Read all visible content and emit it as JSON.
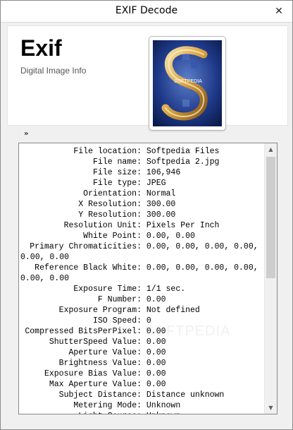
{
  "window": {
    "title": "EXIF Decode",
    "close_glyph": "✕"
  },
  "header": {
    "app_name": "Exif",
    "subtitle": "Digital Image Info",
    "thumbnail_text": "SOFTPEDIA"
  },
  "expand_glyph": "»",
  "exif_rows": [
    {
      "label": "File location:",
      "value": "Softpedia Files"
    },
    {
      "label": "File name:",
      "value": "Softpedia 2.jpg"
    },
    {
      "label": "File size:",
      "value": "106,946"
    },
    {
      "label": "File type:",
      "value": "JPEG"
    },
    {
      "label": "Orientation:",
      "value": "Normal"
    },
    {
      "label": "X Resolution:",
      "value": "300.00"
    },
    {
      "label": "Y Resolution:",
      "value": "300.00"
    },
    {
      "label": "Resolution Unit:",
      "value": "Pixels Per Inch"
    },
    {
      "label": "White Point:",
      "value": "0.00, 0.00"
    },
    {
      "label": "Primary Chromaticities:",
      "value": "0.00, 0.00, 0.00, 0.00,"
    },
    {
      "label": "",
      "value": "0.00, 0.00",
      "wrap": true
    },
    {
      "label": "Reference Black White:",
      "value": "0.00, 0.00, 0.00, 0.00,"
    },
    {
      "label": "",
      "value": "0.00, 0.00",
      "wrap": true
    },
    {
      "label": "Exposure Time:",
      "value": "1/1 sec."
    },
    {
      "label": "F Number:",
      "value": "0.00"
    },
    {
      "label": "Exposure Program:",
      "value": "Not defined"
    },
    {
      "label": "ISO Speed:",
      "value": "0"
    },
    {
      "label": "Compressed BitsPerPixel:",
      "value": "0.00"
    },
    {
      "label": "ShutterSpeed Value:",
      "value": "0.00"
    },
    {
      "label": "Aperture Value:",
      "value": "0.00"
    },
    {
      "label": "Brightness Value:",
      "value": "0.00"
    },
    {
      "label": "Exposure Bias Value:",
      "value": "0.00"
    },
    {
      "label": "Max Aperture Value:",
      "value": "0.00"
    },
    {
      "label": "Subject Distance:",
      "value": "Distance unknown"
    },
    {
      "label": "Metering Mode:",
      "value": "Unknown"
    },
    {
      "label": "Light Source:",
      "value": "Unknown"
    }
  ],
  "scrollbar": {
    "up_glyph": "▲",
    "down_glyph": "▼"
  },
  "colors": {
    "accent": "#0f2a6e",
    "thumb_gold": "#d9a441"
  }
}
